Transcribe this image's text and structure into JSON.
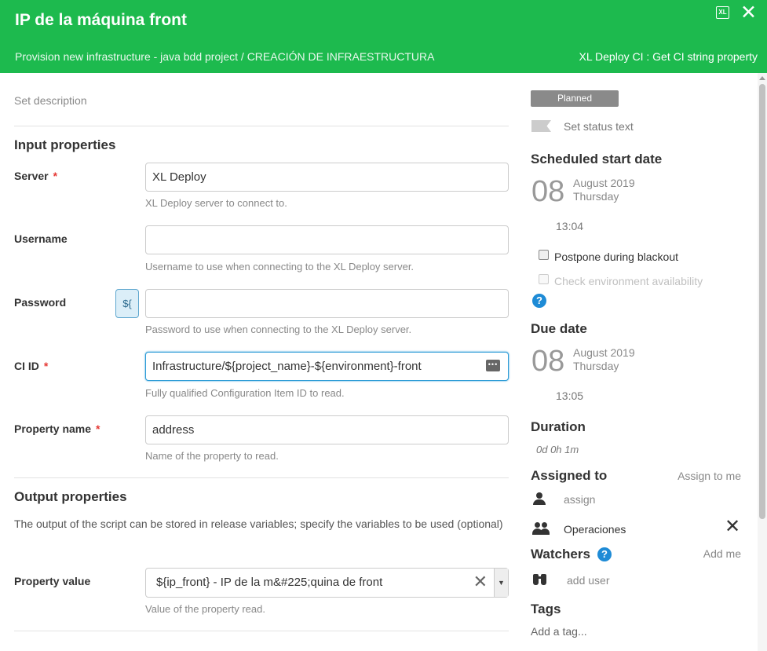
{
  "header": {
    "title": "IP de la máquina front",
    "subtitle": "Provision new infrastructure - java bdd project / CREACIÓN DE INFRAESTRUCTURA",
    "task_type": "XL Deploy CI : Get CI string property",
    "xl_icon_text": "XL",
    "close_glyph": "✕"
  },
  "description_placeholder": "Set description",
  "input_properties": {
    "title": "Input properties",
    "fields": [
      {
        "label": "Server",
        "required": "*",
        "value": "XL Deploy",
        "help": "XL Deploy server to connect to."
      },
      {
        "label": "Username",
        "value": "",
        "help": "Username to use when connecting to the XL Deploy server."
      },
      {
        "label": "Password",
        "value": "",
        "variable_button": "${",
        "help": "Password to use when connecting to the XL Deploy server."
      },
      {
        "label": "CI ID",
        "required": "*",
        "value": "Infrastructure/${project_name}-${environment}-front",
        "help": "Fully qualified Configuration Item ID to read."
      },
      {
        "label": "Property name",
        "required": "*",
        "value": "address",
        "help": "Name of the property to read."
      }
    ]
  },
  "output_properties": {
    "title": "Output properties",
    "description": "The output of the script can be stored in release variables; specify the variables to be used (optional)",
    "field": {
      "label": "Property value",
      "value": "${ip_front} - IP de la m&#225;quina de front",
      "help": "Value of the property read.",
      "clear_glyph": "✕",
      "caret_glyph": "▼"
    }
  },
  "sidebar": {
    "status_badge": "Planned",
    "status_text_placeholder": "Set status text",
    "scheduled_start": {
      "heading": "Scheduled start date",
      "day": "08",
      "month_year": "August 2019",
      "weekday": "Thursday",
      "time": "13:04"
    },
    "postpone_label": "Postpone during blackout",
    "check_env_label": "Check environment availability",
    "help_glyph": "?",
    "due_date": {
      "heading": "Due date",
      "day": "08",
      "month_year": "August 2019",
      "weekday": "Thursday",
      "time": "13:05"
    },
    "duration": {
      "heading": "Duration",
      "value": "0d 0h 1m"
    },
    "assigned_to": {
      "heading": "Assigned to",
      "assign_to_me": "Assign to me",
      "assign_placeholder": "assign",
      "team": "Operaciones",
      "remove_glyph": "✕"
    },
    "watchers": {
      "heading": "Watchers",
      "add_me": "Add me",
      "add_user_placeholder": "add user"
    },
    "tags": {
      "heading": "Tags",
      "placeholder": "Add a tag..."
    }
  },
  "colors": {
    "header_green": "#1dba4e",
    "focus_blue": "#2c9bd6",
    "required_red": "#e53935",
    "help_blue": "#1e8bd6"
  }
}
